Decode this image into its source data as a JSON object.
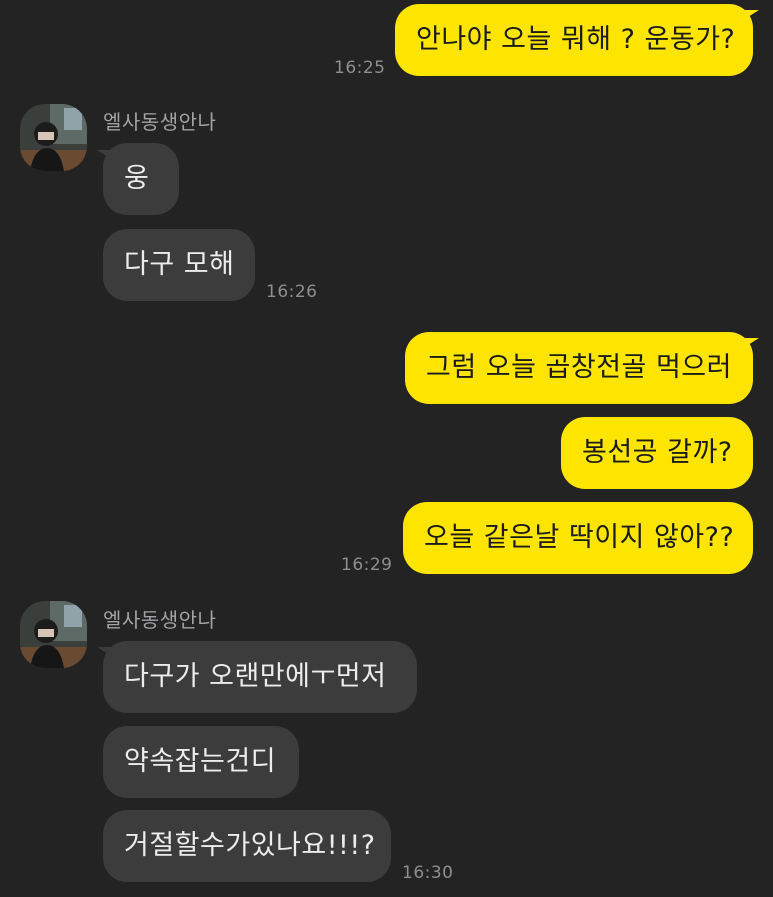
{
  "contact": {
    "name": "엘사동생안나"
  },
  "messages": {
    "m1": "안나야 오늘 뭐해 ? 운동가?",
    "m2": "웅",
    "m3": "다구 모해",
    "m4": "그럼 오늘 곱창전골 먹으러",
    "m5": "봉선공 갈까?",
    "m6": "오늘 같은날 딱이지 않아??",
    "m7": "다구가 오랜만에ㅜ먼저",
    "m8": "약속잡는건디",
    "m9": "거절할수가있나요!!!?"
  },
  "times": {
    "t1": "16:25",
    "t2": "16:26",
    "t3": "16:29",
    "t4": "16:30"
  },
  "colors": {
    "background": "#232324",
    "outgoing_bubble": "#fee500",
    "incoming_bubble": "#3c3c3d"
  },
  "icons": {
    "avatar": "profile-photo"
  }
}
